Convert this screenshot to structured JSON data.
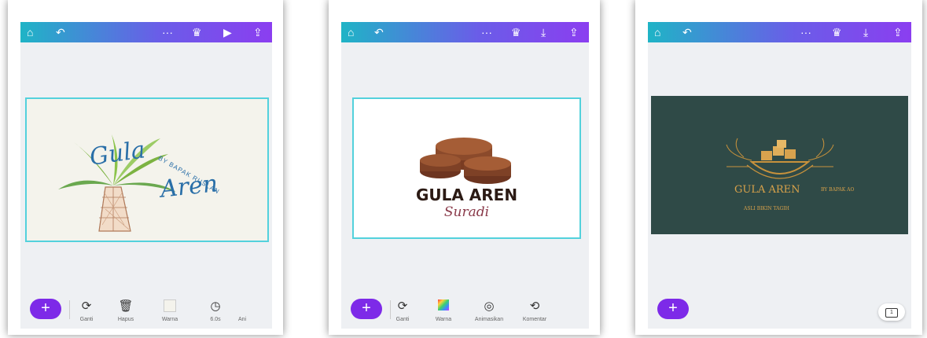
{
  "screens": [
    {
      "tools": [
        {
          "icon": "⟳",
          "label": "Ganti"
        },
        {
          "icon": "🗑",
          "label": "Hapus"
        },
        {
          "icon": "",
          "label": "Warna"
        },
        {
          "icon": "◷",
          "label": "6.0s"
        },
        {
          "icon": "",
          "label": "Ani"
        }
      ],
      "design": {
        "title_line1": "Gula",
        "title_line2": "Aren",
        "arc_text": "BY BAPAK RUSLAN"
      }
    },
    {
      "tools": [
        {
          "icon": "⟳",
          "label": "Ganti"
        },
        {
          "icon": "",
          "label": "Warna"
        },
        {
          "icon": "◎",
          "label": "Animasikan"
        },
        {
          "icon": "⟲",
          "label": "Komentar"
        }
      ],
      "design": {
        "title": "GULA AREN",
        "subtitle": "Suradi"
      }
    },
    {
      "design": {
        "title": "GULA AREN",
        "byline": "BY BAPAK AO",
        "tagline": "ASLI BIKIN TAGIH"
      },
      "page_indicator": "1"
    }
  ],
  "colors": {
    "accent": "#7d2ae8",
    "canvas_border": "#53d1dc",
    "dark_bg": "#2f4a47",
    "gold": "#c8923c"
  }
}
